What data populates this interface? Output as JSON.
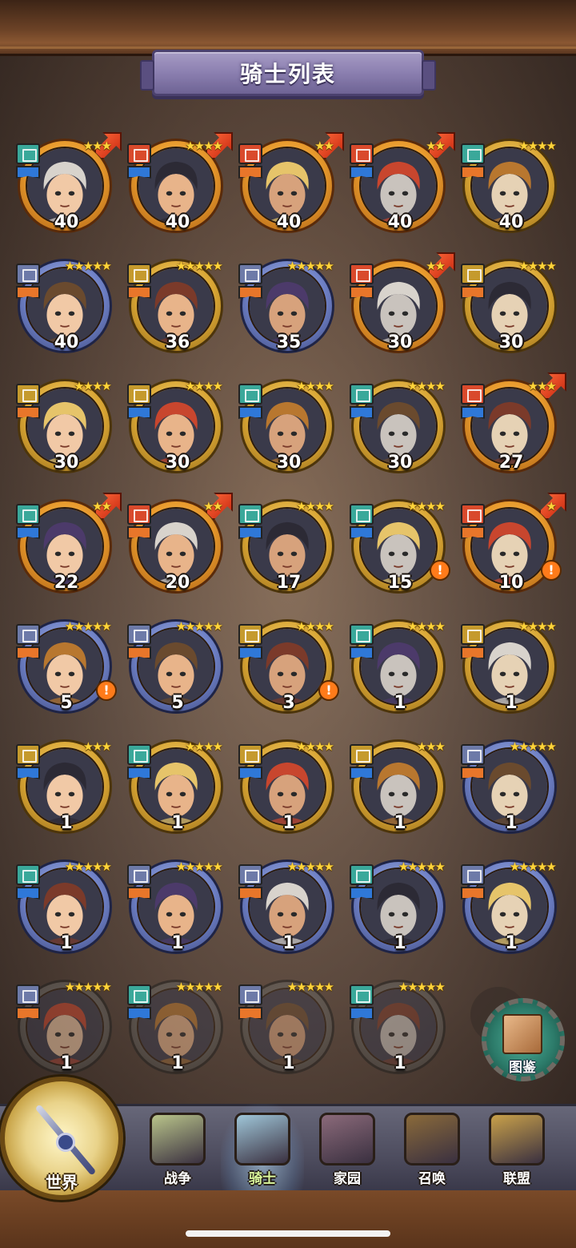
{
  "header": {
    "title": "骑士列表"
  },
  "heroes": [
    {
      "level": "40",
      "frame": "orange",
      "stars": "★★★",
      "arrow": true,
      "class_color": "teal",
      "role": "blue",
      "alert": false
    },
    {
      "level": "40",
      "frame": "orange",
      "stars": "★★★★",
      "arrow": true,
      "class_color": "red",
      "role": "blue",
      "alert": false
    },
    {
      "level": "40",
      "frame": "orange",
      "stars": "★★",
      "arrow": true,
      "class_color": "red",
      "role": "orange",
      "alert": false
    },
    {
      "level": "40",
      "frame": "orange",
      "stars": "★★",
      "arrow": true,
      "class_color": "red",
      "role": "blue",
      "alert": false
    },
    {
      "level": "40",
      "frame": "gold",
      "stars": "★★★★",
      "arrow": false,
      "class_color": "teal",
      "role": "orange",
      "alert": false
    },
    {
      "level": "40",
      "frame": "blue",
      "stars": "★★★★★",
      "arrow": false,
      "class_color": "slate",
      "role": "orange",
      "alert": false
    },
    {
      "level": "36",
      "frame": "gold",
      "stars": "★★★★★",
      "arrow": false,
      "class_color": "gold",
      "role": "orange",
      "alert": false
    },
    {
      "level": "35",
      "frame": "blue",
      "stars": "★★★★★",
      "arrow": false,
      "class_color": "slate",
      "role": "orange",
      "alert": false
    },
    {
      "level": "30",
      "frame": "orange",
      "stars": "★★",
      "arrow": true,
      "class_color": "red",
      "role": "orange",
      "alert": false
    },
    {
      "level": "30",
      "frame": "gold",
      "stars": "★★★★",
      "arrow": false,
      "class_color": "gold",
      "role": "orange",
      "alert": false
    },
    {
      "level": "30",
      "frame": "gold",
      "stars": "★★★★",
      "arrow": false,
      "class_color": "gold",
      "role": "orange",
      "alert": false
    },
    {
      "level": "30",
      "frame": "gold",
      "stars": "★★★★",
      "arrow": false,
      "class_color": "gold",
      "role": "blue",
      "alert": false
    },
    {
      "level": "30",
      "frame": "gold",
      "stars": "★★★★",
      "arrow": false,
      "class_color": "teal",
      "role": "blue",
      "alert": false
    },
    {
      "level": "30",
      "frame": "gold",
      "stars": "★★★★",
      "arrow": false,
      "class_color": "teal",
      "role": "blue",
      "alert": false
    },
    {
      "level": "27",
      "frame": "orange",
      "stars": "★★★",
      "arrow": true,
      "class_color": "red",
      "role": "blue",
      "alert": false
    },
    {
      "level": "22",
      "frame": "orange",
      "stars": "★★",
      "arrow": true,
      "class_color": "teal",
      "role": "blue",
      "alert": false
    },
    {
      "level": "20",
      "frame": "orange",
      "stars": "★★",
      "arrow": true,
      "class_color": "red",
      "role": "orange",
      "alert": false
    },
    {
      "level": "17",
      "frame": "gold",
      "stars": "★★★★",
      "arrow": false,
      "class_color": "teal",
      "role": "blue",
      "alert": false
    },
    {
      "level": "15",
      "frame": "gold",
      "stars": "★★★★",
      "arrow": false,
      "class_color": "teal",
      "role": "blue",
      "alert": true
    },
    {
      "level": "10",
      "frame": "orange",
      "stars": "★",
      "arrow": true,
      "class_color": "red",
      "role": "orange",
      "alert": true
    },
    {
      "level": "5",
      "frame": "blue",
      "stars": "★★★★★",
      "arrow": false,
      "class_color": "slate",
      "role": "orange",
      "alert": true
    },
    {
      "level": "5",
      "frame": "blue",
      "stars": "★★★★★",
      "arrow": false,
      "class_color": "slate",
      "role": "orange",
      "alert": false
    },
    {
      "level": "3",
      "frame": "gold",
      "stars": "★★★★",
      "arrow": false,
      "class_color": "gold",
      "role": "blue",
      "alert": true
    },
    {
      "level": "1",
      "frame": "gold",
      "stars": "★★★★",
      "arrow": false,
      "class_color": "teal",
      "role": "blue",
      "alert": false
    },
    {
      "level": "1",
      "frame": "gold",
      "stars": "★★★★",
      "arrow": false,
      "class_color": "gold",
      "role": "orange",
      "alert": false
    },
    {
      "level": "1",
      "frame": "gold",
      "stars": "★★★",
      "arrow": false,
      "class_color": "gold",
      "role": "blue",
      "alert": false
    },
    {
      "level": "1",
      "frame": "gold",
      "stars": "★★★★",
      "arrow": false,
      "class_color": "teal",
      "role": "blue",
      "alert": false
    },
    {
      "level": "1",
      "frame": "gold",
      "stars": "★★★★",
      "arrow": false,
      "class_color": "gold",
      "role": "blue",
      "alert": false
    },
    {
      "level": "1",
      "frame": "gold",
      "stars": "★★★",
      "arrow": false,
      "class_color": "gold",
      "role": "blue",
      "alert": false
    },
    {
      "level": "1",
      "frame": "blue",
      "stars": "★★★★★",
      "arrow": false,
      "class_color": "slate",
      "role": "orange",
      "alert": false
    },
    {
      "level": "1",
      "frame": "blue",
      "stars": "★★★★★",
      "arrow": false,
      "class_color": "teal",
      "role": "blue",
      "alert": false
    },
    {
      "level": "1",
      "frame": "blue",
      "stars": "★★★★★",
      "arrow": false,
      "class_color": "slate",
      "role": "orange",
      "alert": false
    },
    {
      "level": "1",
      "frame": "blue",
      "stars": "★★★★★",
      "arrow": false,
      "class_color": "slate",
      "role": "orange",
      "alert": false
    },
    {
      "level": "1",
      "frame": "blue",
      "stars": "★★★★★",
      "arrow": false,
      "class_color": "teal",
      "role": "blue",
      "alert": false
    },
    {
      "level": "1",
      "frame": "blue",
      "stars": "★★★★★",
      "arrow": false,
      "class_color": "slate",
      "role": "orange",
      "alert": false
    },
    {
      "level": "1",
      "frame": "gray",
      "stars": "★★★★★",
      "arrow": false,
      "class_color": "slate",
      "role": "orange",
      "alert": false,
      "locked": true
    },
    {
      "level": "1",
      "frame": "gray",
      "stars": "★★★★★",
      "arrow": false,
      "class_color": "teal",
      "role": "blue",
      "alert": false,
      "locked": true
    },
    {
      "level": "1",
      "frame": "gray",
      "stars": "★★★★★",
      "arrow": false,
      "class_color": "slate",
      "role": "orange",
      "alert": false,
      "locked": true
    },
    {
      "level": "1",
      "frame": "gray",
      "stars": "★★★★★",
      "arrow": false,
      "class_color": "teal",
      "role": "blue",
      "alert": false,
      "locked": true
    }
  ],
  "codex": {
    "label": "图鉴",
    "icon": "book-icon"
  },
  "nav": {
    "world": {
      "label": "世界",
      "icon": "compass-icon"
    },
    "items": [
      {
        "label": "战争",
        "icon": "map-icon",
        "active": false,
        "color": "#b9c48a"
      },
      {
        "label": "骑士",
        "icon": "knight-icon",
        "active": true,
        "color": "#9fc6d8"
      },
      {
        "label": "家园",
        "icon": "house-icon",
        "active": false,
        "color": "#8b6a7a"
      },
      {
        "label": "召唤",
        "icon": "train-icon",
        "active": false,
        "color": "#8a6a3a"
      },
      {
        "label": "联盟",
        "icon": "alliance-icon",
        "active": false,
        "color": "#c9a14a"
      }
    ]
  }
}
